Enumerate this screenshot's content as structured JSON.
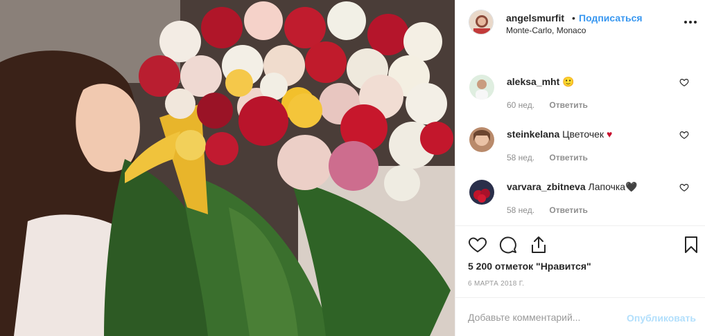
{
  "post": {
    "photo_icon": "photo-girl-smelling-roses",
    "author": {
      "username": "angelsmurfit",
      "separator": "•",
      "follow_label": "Подписаться",
      "location": "Monte-Carlo, Monaco",
      "more_icon": "more-horizontal-icon"
    },
    "comments": [
      {
        "username": "aleksa_mht",
        "text": "🙂",
        "age": "60 нед.",
        "reply_label": "Ответить"
      },
      {
        "username": "steinkelana",
        "text": "Цветочек ♥",
        "age": "58 нед.",
        "reply_label": "Ответить"
      },
      {
        "username": "varvara_zbitneva",
        "text": "Лапочка🖤",
        "age": "58 нед.",
        "reply_label": "Ответить"
      }
    ],
    "actions": {
      "like_icon": "heart-icon",
      "comment_icon": "comment-icon",
      "share_icon": "share-icon",
      "save_icon": "bookmark-icon"
    },
    "likes_text": "5 200 отметок \"Нравится\"",
    "date_text": "6 МАРТА 2018 Г.",
    "add_comment": {
      "placeholder": "Добавьте комментарий...",
      "publish_label": "Опубликовать"
    }
  },
  "colors": {
    "link_blue": "#3897f0",
    "publish_disabled": "#b2dffc",
    "muted_text": "#8e8e8e",
    "divider": "#efefef"
  }
}
